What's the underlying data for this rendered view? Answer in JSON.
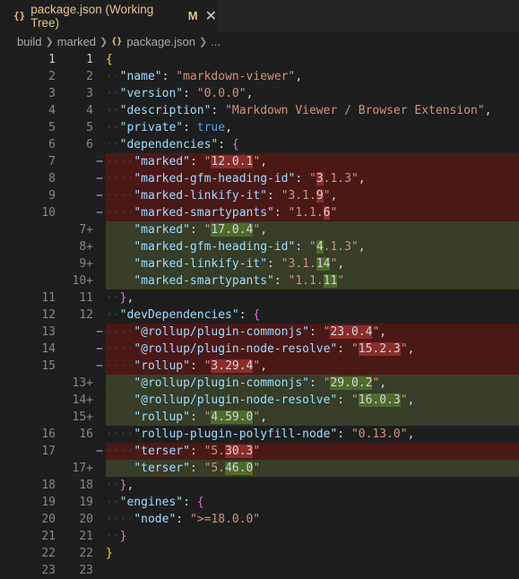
{
  "tab": {
    "icon": "{}",
    "label": "package.json (Working Tree)",
    "badge": "M",
    "close": "✕"
  },
  "breadcrumb": {
    "items": [
      "build",
      "marked"
    ],
    "file_icon": "{}",
    "file": "package.json",
    "more": "..."
  },
  "colors": {
    "deleted_bg": "#4b1818",
    "inserted_bg": "#373d29",
    "key": "#9cdcfe",
    "string": "#ce9178",
    "keyword": "#569cd6"
  },
  "lines": [
    {
      "n1": "1",
      "n2": "1",
      "mark": "",
      "kind": "ctx",
      "code": [
        [
          "b1",
          "{"
        ]
      ]
    },
    {
      "n1": "2",
      "n2": "2",
      "mark": "",
      "kind": "ctx",
      "code": [
        [
          "ws",
          "··"
        ],
        [
          "k",
          "\"name\""
        ],
        [
          "p",
          ": "
        ],
        [
          "s",
          "\"markdown-viewer\""
        ],
        [
          "p",
          ","
        ]
      ]
    },
    {
      "n1": "3",
      "n2": "3",
      "mark": "",
      "kind": "ctx",
      "code": [
        [
          "ws",
          "··"
        ],
        [
          "k",
          "\"version\""
        ],
        [
          "p",
          ": "
        ],
        [
          "s",
          "\"0.0.0\""
        ],
        [
          "p",
          ","
        ]
      ]
    },
    {
      "n1": "4",
      "n2": "4",
      "mark": "",
      "kind": "ctx",
      "code": [
        [
          "ws",
          "··"
        ],
        [
          "k",
          "\"description\""
        ],
        [
          "p",
          ": "
        ],
        [
          "s",
          "\"Markdown Viewer / Browser Extension\""
        ],
        [
          "p",
          ","
        ]
      ]
    },
    {
      "n1": "5",
      "n2": "5",
      "mark": "",
      "kind": "ctx",
      "code": [
        [
          "ws",
          "··"
        ],
        [
          "k",
          "\"private\""
        ],
        [
          "p",
          ": "
        ],
        [
          "kw",
          "true"
        ],
        [
          "p",
          ","
        ]
      ]
    },
    {
      "n1": "6",
      "n2": "6",
      "mark": "",
      "kind": "ctx",
      "code": [
        [
          "ws",
          "··"
        ],
        [
          "k",
          "\"dependencies\""
        ],
        [
          "p",
          ": "
        ],
        [
          "b2",
          "{"
        ]
      ]
    },
    {
      "n1": "7",
      "n2": "",
      "mark": "−",
      "kind": "del",
      "code": [
        [
          "ws",
          "····"
        ],
        [
          "k",
          "\"marked\""
        ],
        [
          "p",
          ": "
        ],
        [
          "s",
          "\""
        ],
        [
          "chg-del",
          "12.0.1"
        ],
        [
          "s",
          "\""
        ],
        [
          "p",
          ","
        ]
      ]
    },
    {
      "n1": "8",
      "n2": "",
      "mark": "−",
      "kind": "del",
      "code": [
        [
          "ws",
          "····"
        ],
        [
          "k",
          "\"marked-gfm-heading-id\""
        ],
        [
          "p",
          ": "
        ],
        [
          "s",
          "\""
        ],
        [
          "chg-del",
          "3"
        ],
        [
          "s",
          ".1.3\""
        ],
        [
          "p",
          ","
        ]
      ]
    },
    {
      "n1": "9",
      "n2": "",
      "mark": "−",
      "kind": "del",
      "code": [
        [
          "ws",
          "····"
        ],
        [
          "k",
          "\"marked-linkify-it\""
        ],
        [
          "p",
          ": "
        ],
        [
          "s",
          "\"3.1."
        ],
        [
          "chg-del",
          "9"
        ],
        [
          "s",
          "\""
        ],
        [
          "p",
          ","
        ]
      ]
    },
    {
      "n1": "10",
      "n2": "",
      "mark": "−",
      "kind": "del",
      "code": [
        [
          "ws",
          "····"
        ],
        [
          "k",
          "\"marked-smartypants\""
        ],
        [
          "p",
          ": "
        ],
        [
          "s",
          "\"1.1."
        ],
        [
          "chg-del",
          "6"
        ],
        [
          "s",
          "\""
        ]
      ]
    },
    {
      "n1": "",
      "n2": "7+",
      "mark": "",
      "kind": "ins",
      "code": [
        [
          "ws",
          "····"
        ],
        [
          "k",
          "\"marked\""
        ],
        [
          "p",
          ": "
        ],
        [
          "s",
          "\""
        ],
        [
          "chg-ins",
          "17.0.4"
        ],
        [
          "s",
          "\""
        ],
        [
          "p",
          ","
        ]
      ]
    },
    {
      "n1": "",
      "n2": "8+",
      "mark": "",
      "kind": "ins",
      "code": [
        [
          "ws",
          "····"
        ],
        [
          "k",
          "\"marked-gfm-heading-id\""
        ],
        [
          "p",
          ": "
        ],
        [
          "s",
          "\""
        ],
        [
          "chg-ins",
          "4"
        ],
        [
          "s",
          ".1.3\""
        ],
        [
          "p",
          ","
        ]
      ]
    },
    {
      "n1": "",
      "n2": "9+",
      "mark": "",
      "kind": "ins",
      "code": [
        [
          "ws",
          "····"
        ],
        [
          "k",
          "\"marked-linkify-it\""
        ],
        [
          "p",
          ": "
        ],
        [
          "s",
          "\"3.1."
        ],
        [
          "chg-ins",
          "14"
        ],
        [
          "s",
          "\""
        ],
        [
          "p",
          ","
        ]
      ]
    },
    {
      "n1": "",
      "n2": "10+",
      "mark": "",
      "kind": "ins",
      "code": [
        [
          "ws",
          "····"
        ],
        [
          "k",
          "\"marked-smartypants\""
        ],
        [
          "p",
          ": "
        ],
        [
          "s",
          "\"1.1."
        ],
        [
          "chg-ins",
          "11"
        ],
        [
          "s",
          "\""
        ]
      ]
    },
    {
      "n1": "11",
      "n2": "11",
      "mark": "",
      "kind": "ctx",
      "code": [
        [
          "ws",
          "··"
        ],
        [
          "b2",
          "}"
        ],
        [
          "p",
          ","
        ]
      ]
    },
    {
      "n1": "12",
      "n2": "12",
      "mark": "",
      "kind": "ctx",
      "code": [
        [
          "ws",
          "··"
        ],
        [
          "k",
          "\"devDependencies\""
        ],
        [
          "p",
          ": "
        ],
        [
          "b2",
          "{"
        ]
      ]
    },
    {
      "n1": "13",
      "n2": "",
      "mark": "−",
      "kind": "del",
      "code": [
        [
          "ws",
          "····"
        ],
        [
          "k",
          "\"@rollup/plugin-commonjs\""
        ],
        [
          "p",
          ": "
        ],
        [
          "s",
          "\""
        ],
        [
          "chg-del",
          "23.0.4"
        ],
        [
          "s",
          "\""
        ],
        [
          "p",
          ","
        ]
      ]
    },
    {
      "n1": "14",
      "n2": "",
      "mark": "−",
      "kind": "del",
      "code": [
        [
          "ws",
          "····"
        ],
        [
          "k",
          "\"@rollup/plugin-node-resolve\""
        ],
        [
          "p",
          ": "
        ],
        [
          "s",
          "\""
        ],
        [
          "chg-del",
          "15.2.3"
        ],
        [
          "s",
          "\""
        ],
        [
          "p",
          ","
        ]
      ]
    },
    {
      "n1": "15",
      "n2": "",
      "mark": "−",
      "kind": "del",
      "code": [
        [
          "ws",
          "····"
        ],
        [
          "k",
          "\"rollup\""
        ],
        [
          "p",
          ": "
        ],
        [
          "s",
          "\""
        ],
        [
          "chg-del",
          "3.29.4"
        ],
        [
          "s",
          "\""
        ],
        [
          "p",
          ","
        ]
      ]
    },
    {
      "n1": "",
      "n2": "13+",
      "mark": "",
      "kind": "ins",
      "code": [
        [
          "ws",
          "····"
        ],
        [
          "k",
          "\"@rollup/plugin-commonjs\""
        ],
        [
          "p",
          ": "
        ],
        [
          "s",
          "\""
        ],
        [
          "chg-ins",
          "29.0.2"
        ],
        [
          "s",
          "\""
        ],
        [
          "p",
          ","
        ]
      ]
    },
    {
      "n1": "",
      "n2": "14+",
      "mark": "",
      "kind": "ins",
      "code": [
        [
          "ws",
          "····"
        ],
        [
          "k",
          "\"@rollup/plugin-node-resolve\""
        ],
        [
          "p",
          ": "
        ],
        [
          "s",
          "\""
        ],
        [
          "chg-ins",
          "16.0.3"
        ],
        [
          "s",
          "\""
        ],
        [
          "p",
          ","
        ]
      ]
    },
    {
      "n1": "",
      "n2": "15+",
      "mark": "",
      "kind": "ins",
      "code": [
        [
          "ws",
          "····"
        ],
        [
          "k",
          "\"rollup\""
        ],
        [
          "p",
          ": "
        ],
        [
          "s",
          "\""
        ],
        [
          "chg-ins",
          "4.59.0"
        ],
        [
          "s",
          "\""
        ],
        [
          "p",
          ","
        ]
      ]
    },
    {
      "n1": "16",
      "n2": "16",
      "mark": "",
      "kind": "ctx",
      "code": [
        [
          "ws",
          "····"
        ],
        [
          "k",
          "\"rollup-plugin-polyfill-node\""
        ],
        [
          "p",
          ": "
        ],
        [
          "s",
          "\"0.13.0\""
        ],
        [
          "p",
          ","
        ]
      ]
    },
    {
      "n1": "17",
      "n2": "",
      "mark": "−",
      "kind": "del",
      "code": [
        [
          "ws",
          "····"
        ],
        [
          "k",
          "\"terser\""
        ],
        [
          "p",
          ": "
        ],
        [
          "s",
          "\"5."
        ],
        [
          "chg-del",
          "30.3"
        ],
        [
          "s",
          "\""
        ]
      ]
    },
    {
      "n1": "",
      "n2": "17+",
      "mark": "",
      "kind": "ins",
      "code": [
        [
          "ws",
          "····"
        ],
        [
          "k",
          "\"terser\""
        ],
        [
          "p",
          ": "
        ],
        [
          "s",
          "\"5."
        ],
        [
          "chg-ins",
          "46.0"
        ],
        [
          "s",
          "\""
        ]
      ]
    },
    {
      "n1": "18",
      "n2": "18",
      "mark": "",
      "kind": "ctx",
      "code": [
        [
          "ws",
          "··"
        ],
        [
          "b2",
          "}"
        ],
        [
          "p",
          ","
        ]
      ]
    },
    {
      "n1": "19",
      "n2": "19",
      "mark": "",
      "kind": "ctx",
      "code": [
        [
          "ws",
          "··"
        ],
        [
          "k",
          "\"engines\""
        ],
        [
          "p",
          ": "
        ],
        [
          "b2",
          "{"
        ]
      ]
    },
    {
      "n1": "20",
      "n2": "20",
      "mark": "",
      "kind": "ctx",
      "code": [
        [
          "ws",
          "····"
        ],
        [
          "k",
          "\"node\""
        ],
        [
          "p",
          ": "
        ],
        [
          "s",
          "\">=18.0.0\""
        ]
      ]
    },
    {
      "n1": "21",
      "n2": "21",
      "mark": "",
      "kind": "ctx",
      "code": [
        [
          "ws",
          "··"
        ],
        [
          "b2",
          "}"
        ]
      ]
    },
    {
      "n1": "22",
      "n2": "22",
      "mark": "",
      "kind": "ctx",
      "code": [
        [
          "b1",
          "}"
        ]
      ]
    },
    {
      "n1": "23",
      "n2": "23",
      "mark": "",
      "kind": "ctx",
      "code": []
    }
  ]
}
